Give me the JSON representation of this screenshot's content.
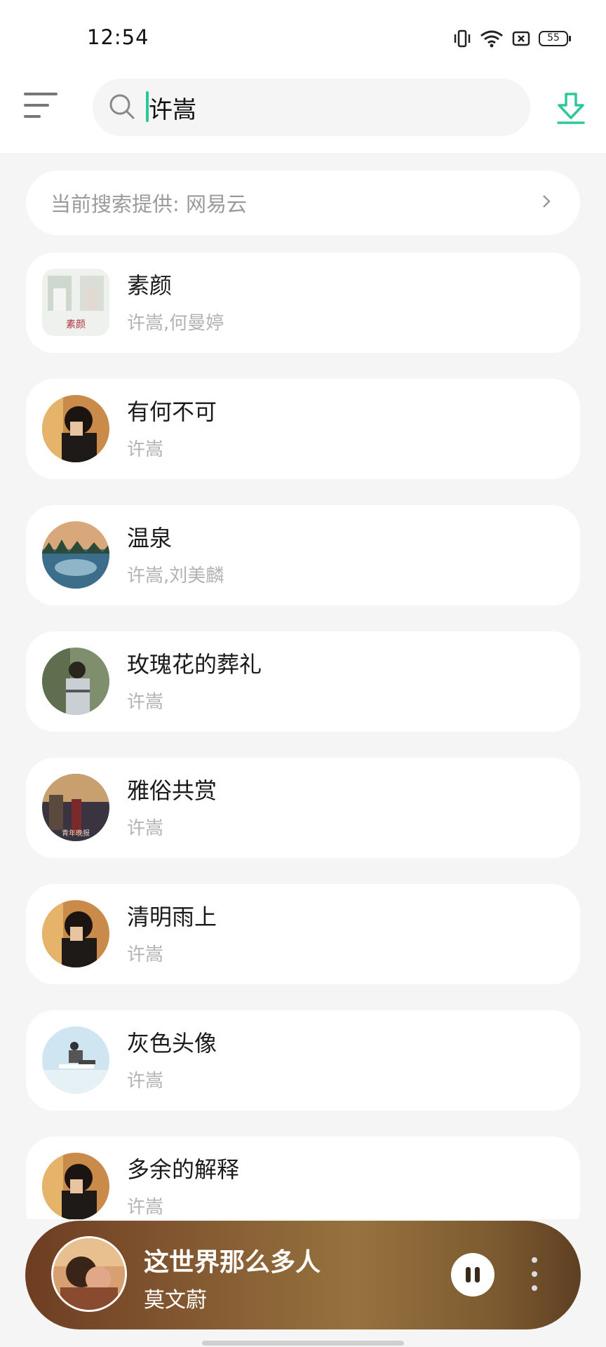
{
  "status_bar": {
    "time": "12:54",
    "battery": "55",
    "icons": [
      "vibrate-icon",
      "wifi-icon",
      "sim-icon",
      "battery-icon"
    ]
  },
  "header": {
    "menu_icon": "menu-icon",
    "search_icon": "search-icon",
    "search_value": "许嵩",
    "download_icon": "download-icon",
    "accent_color": "#2ec79a"
  },
  "provider": {
    "label": "当前搜索提供: 网易云",
    "chevron_icon": "chevron-right-icon"
  },
  "songs": [
    {
      "title": "素颜",
      "artist": "许嵩,何曼婷"
    },
    {
      "title": "有何不可",
      "artist": "许嵩"
    },
    {
      "title": "温泉",
      "artist": "许嵩,刘美麟"
    },
    {
      "title": "玫瑰花的葬礼",
      "artist": "许嵩"
    },
    {
      "title": "雅俗共赏",
      "artist": "许嵩"
    },
    {
      "title": "清明雨上",
      "artist": "许嵩"
    },
    {
      "title": "灰色头像",
      "artist": "许嵩"
    },
    {
      "title": "多余的解释",
      "artist": "许嵩"
    }
  ],
  "cover_text": {
    "suyan": "素颜",
    "yasu": "青年晚报"
  },
  "player": {
    "title": "这世界那么多人",
    "artist": "莫文蔚",
    "pause_icon": "pause-icon",
    "more_icon": "more-vertical-icon"
  }
}
